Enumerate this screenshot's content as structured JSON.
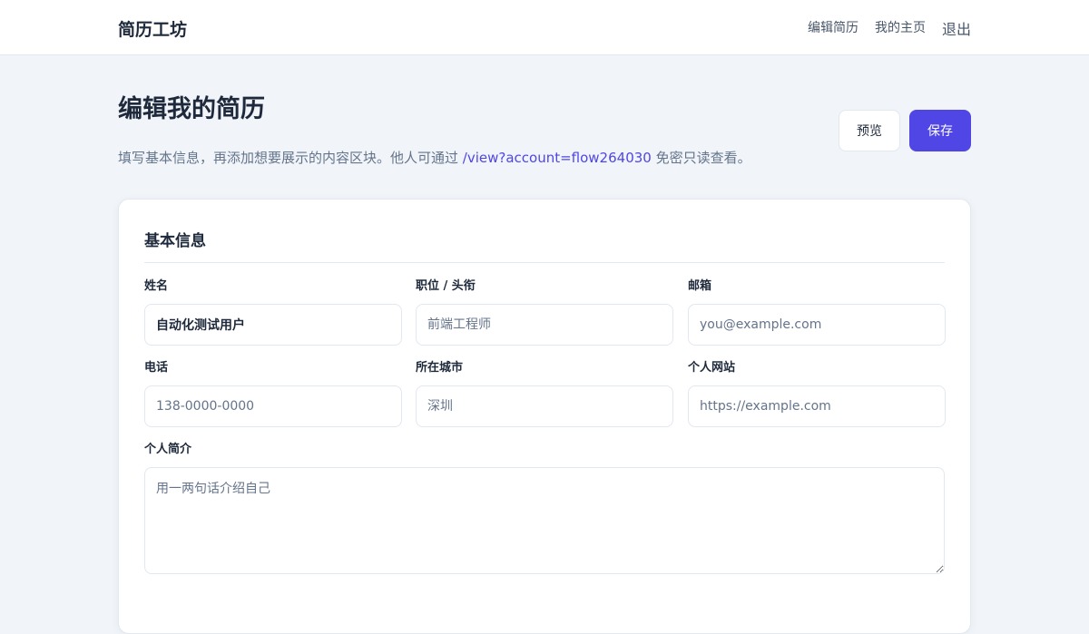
{
  "header": {
    "brand": "简历工坊",
    "nav": {
      "edit": "编辑简历",
      "home": "我的主页",
      "logout": "退出"
    }
  },
  "page": {
    "title": "编辑我的简历",
    "description_prefix": "填写基本信息，再添加想要展示的内容区块。他人可通过 ",
    "view_link": "/view?account=flow264030",
    "description_suffix": " 免密只读查看。",
    "actions": {
      "preview": "预览",
      "save": "保存"
    }
  },
  "basic_info": {
    "title": "基本信息",
    "fields": {
      "name": {
        "label": "姓名",
        "value": "自动化测试用户",
        "placeholder": ""
      },
      "position": {
        "label": "职位 / 头衔",
        "value": "",
        "placeholder": "前端工程师"
      },
      "email": {
        "label": "邮箱",
        "value": "",
        "placeholder": "you@example.com"
      },
      "phone": {
        "label": "电话",
        "value": "",
        "placeholder": "138-0000-0000"
      },
      "city": {
        "label": "所在城市",
        "value": "",
        "placeholder": "深圳"
      },
      "website": {
        "label": "个人网站",
        "value": "",
        "placeholder": "https://example.com"
      },
      "bio": {
        "label": "个人简介",
        "value": "",
        "placeholder": "用一两句话介绍自己"
      }
    }
  },
  "colors": {
    "accent": "#4f46e5",
    "background": "#f1f5f9",
    "border": "#e2e8f0"
  }
}
